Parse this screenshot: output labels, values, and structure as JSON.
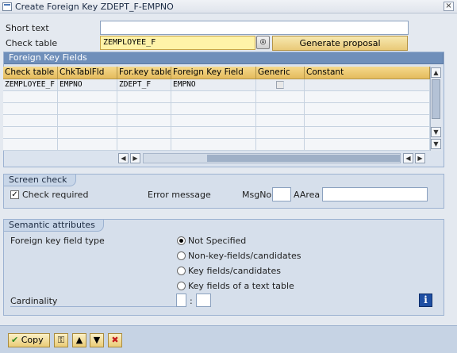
{
  "window": {
    "title": "Create Foreign Key ZDEPT_F-EMPNO",
    "close_glyph": "×"
  },
  "form": {
    "short_text_label": "Short text",
    "short_text_value": "",
    "check_table_label": "Check table",
    "check_table_value": "ZEMPLOYEE_F",
    "generate_proposal_label": "Generate proposal"
  },
  "fk_fields": {
    "title": "Foreign Key Fields",
    "columns": [
      "Check table",
      "ChkTablFld",
      "For.key table",
      "Foreign Key Field",
      "Generic",
      "Constant"
    ],
    "rows": [
      {
        "check_table": "ZEMPLOYEE_F",
        "chk_field": "EMPNO",
        "for_key_table": "ZDEPT_F",
        "fk_field": "EMPNO",
        "generic": false,
        "constant": ""
      }
    ]
  },
  "screen_check": {
    "title": "Screen check",
    "check_required_label": "Check required",
    "check_required": true,
    "error_message_label": "Error message",
    "msgno_label": "MsgNo",
    "msgno_value": "",
    "aarea_label": "AArea",
    "aarea_value": ""
  },
  "semantic": {
    "title": "Semantic attributes",
    "fk_field_type_label": "Foreign key field type",
    "options": [
      "Not Specified",
      "Non-key-fields/candidates",
      "Key fields/candidates",
      "Key fields of a text table"
    ],
    "selected_index": 0,
    "cardinality_label": "Cardinality",
    "cardinality_left": "",
    "cardinality_sep": ":",
    "cardinality_right": "",
    "info_icon": "i"
  },
  "toolbar": {
    "copy_label": "Copy"
  },
  "colors": {
    "highlight": "#fff3a8",
    "header": "#e4bb5d",
    "group": "#d6dfeb"
  }
}
